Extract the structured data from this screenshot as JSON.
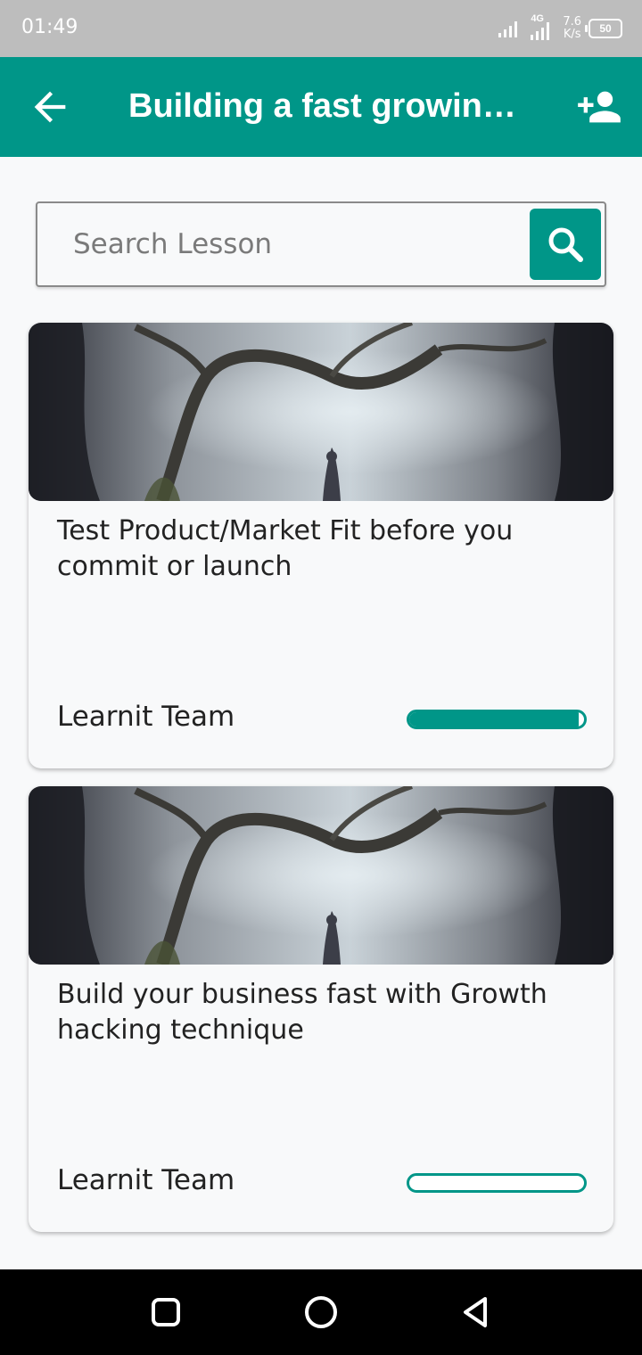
{
  "status_bar": {
    "time": "01:49",
    "network": "4G",
    "net_speed_value": "7.6",
    "net_speed_unit": "K/s",
    "battery": "50"
  },
  "app_bar": {
    "title": "Building a fast growing...",
    "back_icon": "arrow-left-icon",
    "add_icon": "person-add-icon"
  },
  "search": {
    "placeholder": "Search Lesson",
    "value": "",
    "button_icon": "search-icon"
  },
  "lessons": [
    {
      "title": "Test  Product/Market Fit before you commit or launch",
      "author": "Learnit Team",
      "progress": 0.97
    },
    {
      "title": "Build your business fast with Growth hacking technique",
      "author": "Learnit Team",
      "progress": 0.0
    }
  ],
  "colors": {
    "primary": "#009688",
    "status_bar": "#bdbdbd",
    "background": "#f8f9fa"
  }
}
